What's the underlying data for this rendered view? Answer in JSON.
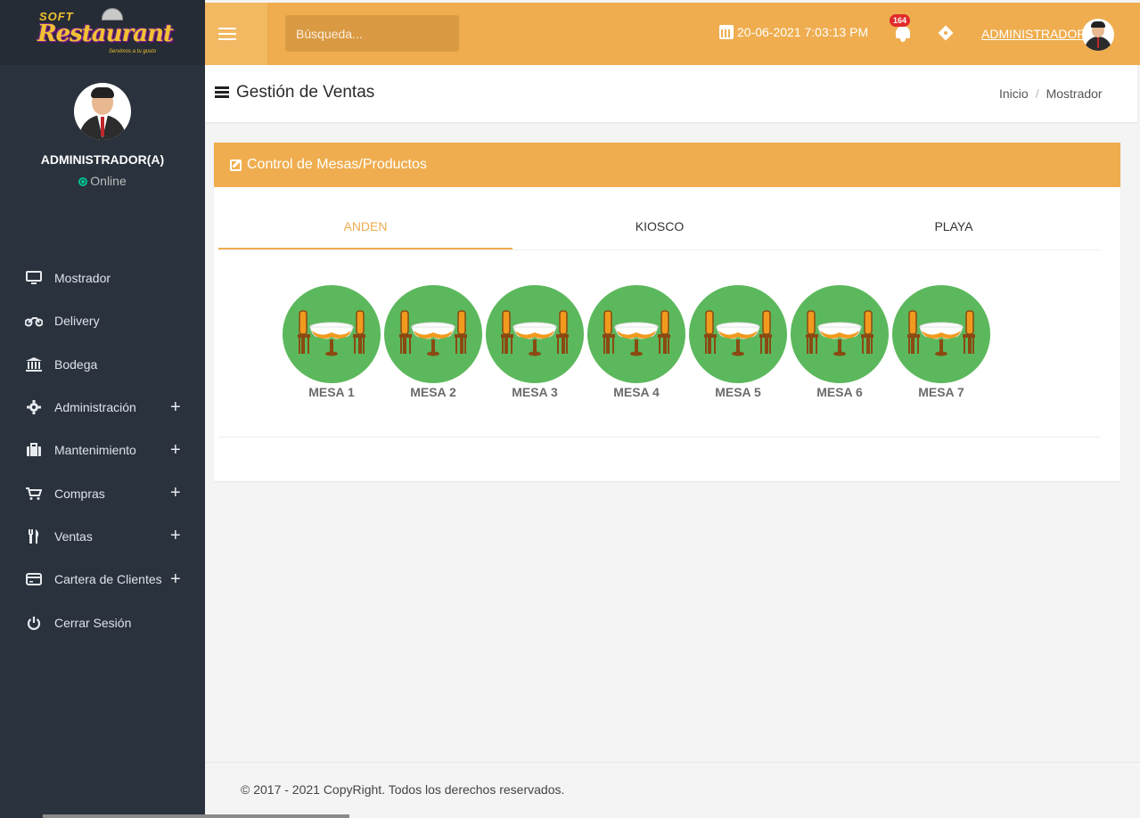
{
  "brand": {
    "logo_text_small": "SOFT",
    "logo_text_main": "Restaurant",
    "logo_tagline": "Servimos a tu gusto"
  },
  "profile": {
    "name": "ADMINISTRADOR(A)",
    "status": "Online"
  },
  "sidebar": {
    "items": [
      {
        "label": "Mostrador",
        "icon": "monitor-icon",
        "expandable": false
      },
      {
        "label": "Delivery",
        "icon": "motorcycle-icon",
        "expandable": false
      },
      {
        "label": "Bodega",
        "icon": "bank-icon",
        "expandable": false
      },
      {
        "label": "Administración",
        "icon": "gear-icon",
        "expandable": true
      },
      {
        "label": "Mantenimiento",
        "icon": "briefcase-icon",
        "expandable": true
      },
      {
        "label": "Compras",
        "icon": "cart-icon",
        "expandable": true
      },
      {
        "label": "Ventas",
        "icon": "cutlery-icon",
        "expandable": true
      },
      {
        "label": "Cartera de Clientes",
        "icon": "credit-card-icon",
        "expandable": true
      },
      {
        "label": "Cerrar Sesión",
        "icon": "power-icon",
        "expandable": false
      }
    ],
    "expand_symbol": "+"
  },
  "topbar": {
    "search_placeholder": "Búsqueda...",
    "datetime": "20-06-2021 7:03:13 PM",
    "notification_count": "164",
    "user": "ADMINISTRADOR"
  },
  "page": {
    "title": "Gestión de Ventas",
    "breadcrumb": [
      "Inicio",
      "Mostrador"
    ]
  },
  "panel": {
    "title": "Control de Mesas/Productos",
    "tabs": [
      "ANDEN",
      "KIOSCO",
      "PLAYA"
    ],
    "active_tab": "ANDEN",
    "tables": [
      "MESA 1",
      "MESA 2",
      "MESA 3",
      "MESA 4",
      "MESA 5",
      "MESA 6",
      "MESA 7"
    ],
    "table_color": "#5cb85c"
  },
  "footer": {
    "text": "© 2017 - 2021 CopyRight. Todos los derechos reservados."
  },
  "colors": {
    "accent": "#efad4f",
    "sidebar": "#2a323d",
    "available": "#5cb85c",
    "badge": "#e02b2b"
  }
}
